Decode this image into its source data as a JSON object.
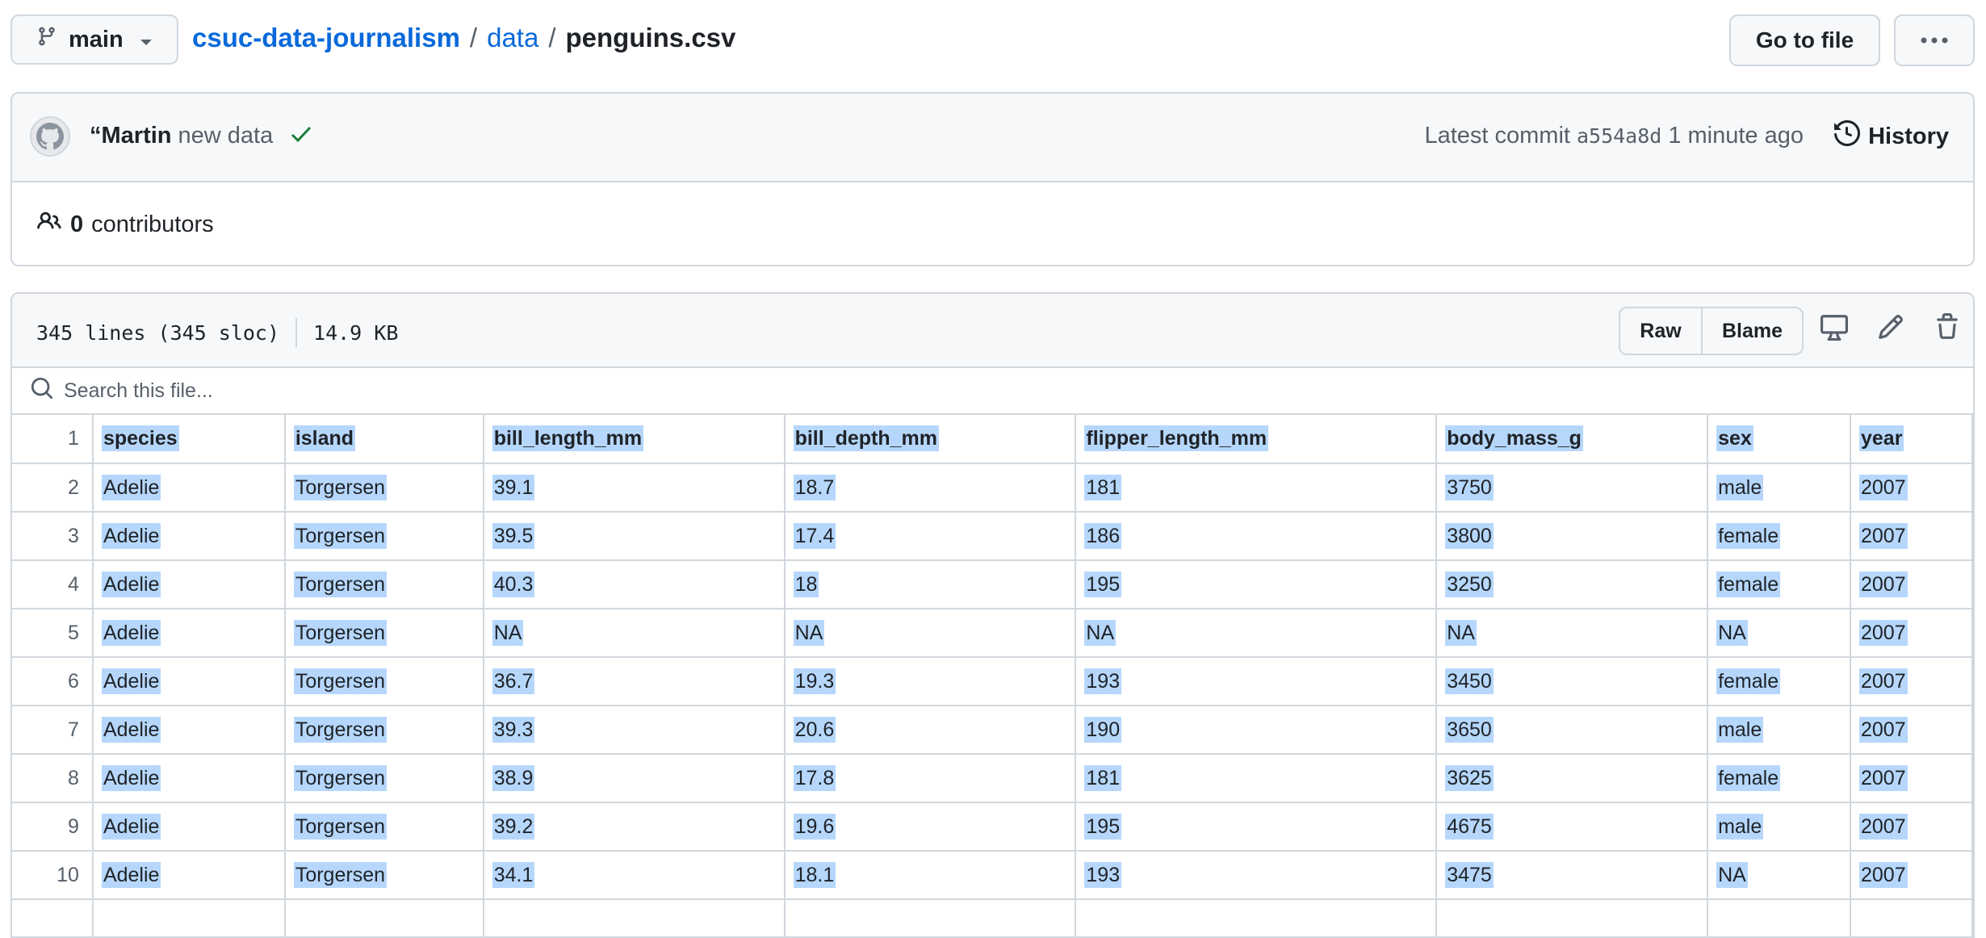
{
  "topbar": {
    "branch": "main",
    "repo": "csuc-data-journalism",
    "sep1": "/",
    "folder": "data",
    "sep2": "/",
    "file": "penguins.csv",
    "goto_label": "Go to file",
    "more_icon": "kebab-horizontal-icon"
  },
  "commit": {
    "author": "“Martin",
    "message": "new data",
    "status_icon": "check-icon",
    "latest_label": "Latest commit",
    "sha": "a554a8d",
    "time": "1 minute ago",
    "history_label": "History",
    "status_color": "#1a7f37"
  },
  "contributors": {
    "count": "0",
    "label": "contributors"
  },
  "file": {
    "lines": "345 lines (345 sloc)",
    "size": "14.9 KB",
    "raw_label": "Raw",
    "blame_label": "Blame",
    "search_placeholder": "Search this file..."
  },
  "table": {
    "header": [
      "species",
      "island",
      "bill_length_mm",
      "bill_depth_mm",
      "flipper_length_mm",
      "body_mass_g",
      "sex",
      "year"
    ],
    "rows": [
      [
        "Adelie",
        "Torgersen",
        "39.1",
        "18.7",
        "181",
        "3750",
        "male",
        "2007"
      ],
      [
        "Adelie",
        "Torgersen",
        "39.5",
        "17.4",
        "186",
        "3800",
        "female",
        "2007"
      ],
      [
        "Adelie",
        "Torgersen",
        "40.3",
        "18",
        "195",
        "3250",
        "female",
        "2007"
      ],
      [
        "Adelie",
        "Torgersen",
        "NA",
        "NA",
        "NA",
        "NA",
        "NA",
        "2007"
      ],
      [
        "Adelie",
        "Torgersen",
        "36.7",
        "19.3",
        "193",
        "3450",
        "female",
        "2007"
      ],
      [
        "Adelie",
        "Torgersen",
        "39.3",
        "20.6",
        "190",
        "3650",
        "male",
        "2007"
      ],
      [
        "Adelie",
        "Torgersen",
        "38.9",
        "17.8",
        "181",
        "3625",
        "female",
        "2007"
      ],
      [
        "Adelie",
        "Torgersen",
        "39.2",
        "19.6",
        "195",
        "4675",
        "male",
        "2007"
      ],
      [
        "Adelie",
        "Torgersen",
        "34.1",
        "18.1",
        "193",
        "3475",
        "NA",
        "2007"
      ],
      [
        "",
        "",
        "",
        "",
        "",
        "",
        "",
        ""
      ]
    ],
    "line_numbers": [
      "1",
      "2",
      "3",
      "4",
      "5",
      "6",
      "7",
      "8",
      "9",
      "10",
      ""
    ],
    "selection_color": "#b6d7fb"
  }
}
